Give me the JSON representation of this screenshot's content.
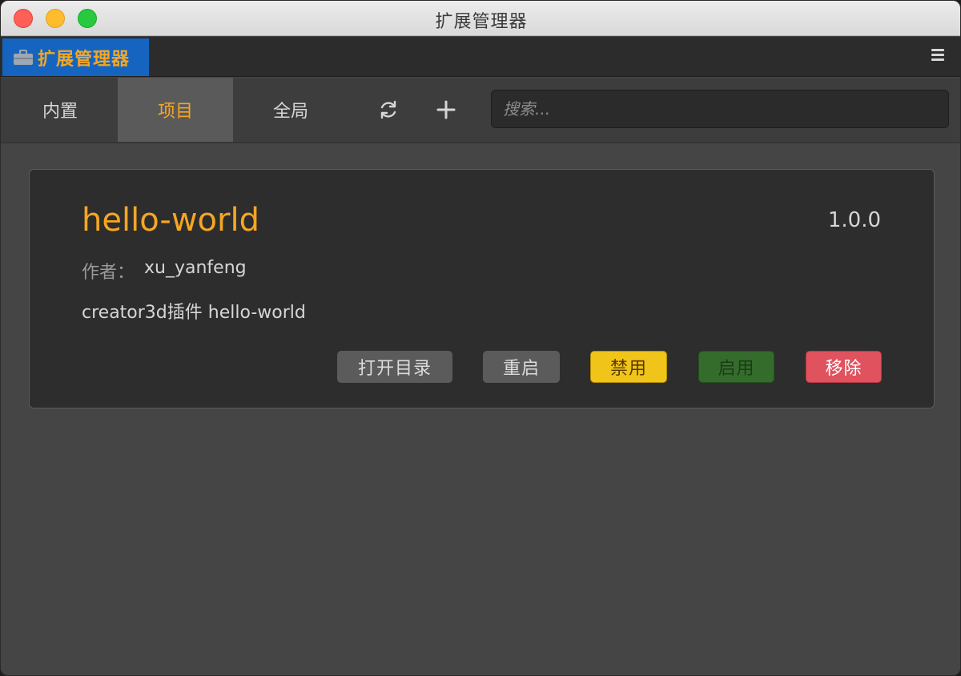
{
  "window": {
    "title": "扩展管理器"
  },
  "panel": {
    "tab_label": "扩展管理器",
    "tab_icon": "toolbox-icon",
    "menu_icon": "hamburger-menu-icon"
  },
  "tabs": [
    {
      "label": "内置",
      "active": false
    },
    {
      "label": "项目",
      "active": true
    },
    {
      "label": "全局",
      "active": false
    }
  ],
  "toolbar": {
    "refresh_icon": "refresh-icon",
    "add_icon": "plus-icon",
    "search_placeholder": "搜索..."
  },
  "extension": {
    "name": "hello-world",
    "version": "1.0.0",
    "author_label": "作者：",
    "author": "xu_yanfeng",
    "description": "creator3d插件 hello-world",
    "buttons": {
      "open_folder": "打开目录",
      "restart": "重启",
      "disable": "禁用",
      "enable": "启用",
      "remove": "移除"
    }
  },
  "colors": {
    "accent": "#f5a623",
    "panel_tab_bg": "#1565c0",
    "disable_btn": "#f0c419",
    "enable_btn": "#346d2b",
    "remove_btn": "#e0525e"
  }
}
